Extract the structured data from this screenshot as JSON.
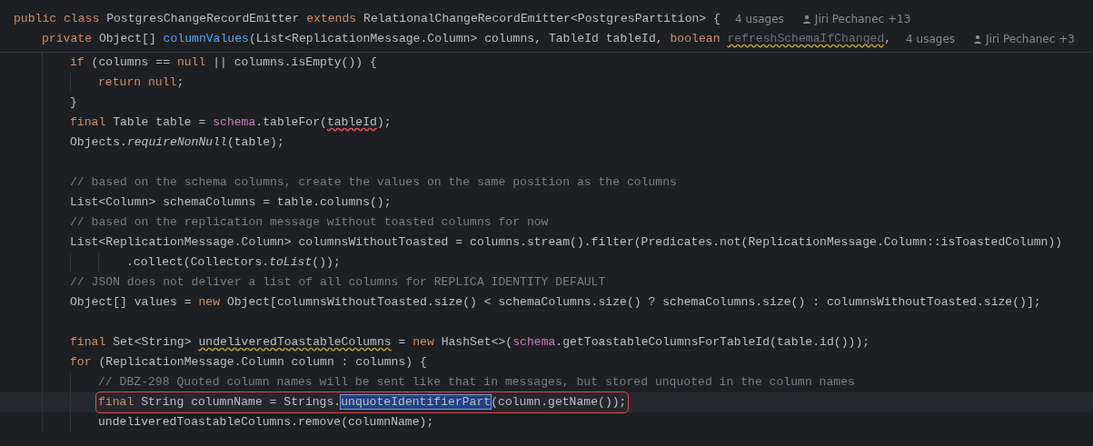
{
  "sticky_header": [
    {
      "tokens": [
        {
          "text": "public class ",
          "kind": "keyword"
        },
        {
          "text": "PostgresChangeRecordEmitter ",
          "kind": "plain"
        },
        {
          "text": "extends ",
          "kind": "keyword"
        },
        {
          "text": "RelationalChangeRecordEmitter<PostgresPartition> {",
          "kind": "plain"
        }
      ],
      "usages": "4 usages",
      "author": "Jiri Pechanec +13",
      "children": [
        {
          "tokens": [
            {
              "text": "private ",
              "kind": "keyword"
            },
            {
              "text": "Object[] ",
              "kind": "plain"
            },
            {
              "text": "columnValues",
              "kind": "declaration"
            },
            {
              "text": "(List<ReplicationMessage.Column> columns, TableId tableId, ",
              "kind": "plain"
            },
            {
              "text": "boolean ",
              "kind": "keyword"
            },
            {
              "text": "refreshSchemaIfChanged",
              "kind": "unused"
            },
            {
              "text": ",",
              "kind": "plain"
            }
          ],
          "usages": "4 usages",
          "author": "Jiri Pechanec +3"
        }
      ]
    }
  ],
  "lines": [
    {
      "kind": "code",
      "tokens": [
        {
          "text": "if ",
          "kind": "keyword"
        },
        {
          "text": "(columns == ",
          "kind": "plain"
        },
        {
          "text": "null",
          "kind": "keyword"
        },
        {
          "text": " || columns.isEmpty()) {",
          "kind": "plain"
        }
      ],
      "children": [
        {
          "kind": "code",
          "tokens": [
            {
              "text": "return null",
              "kind": "keyword"
            },
            {
              "text": ";",
              "kind": "plain"
            }
          ]
        }
      ]
    },
    {
      "kind": "code",
      "tokens": [
        {
          "text": "}",
          "kind": "plain"
        }
      ]
    },
    {
      "kind": "code",
      "tokens": [
        {
          "text": "final ",
          "kind": "keyword"
        },
        {
          "text": "Table table = ",
          "kind": "plain"
        },
        {
          "text": "schema",
          "kind": "field"
        },
        {
          "text": ".tableFor(",
          "kind": "plain"
        },
        {
          "text": "tableId",
          "kind": "error"
        },
        {
          "text": ");",
          "kind": "plain"
        }
      ]
    },
    {
      "kind": "code",
      "tokens": [
        {
          "text": "Objects.",
          "kind": "plain"
        },
        {
          "text": "requireNonNull",
          "kind": "static"
        },
        {
          "text": "(table);",
          "kind": "plain"
        }
      ]
    },
    {
      "kind": "blank"
    },
    {
      "kind": "code",
      "tokens": [
        {
          "text": "// based on the schema columns, create the values on the same position as the columns",
          "kind": "comment"
        }
      ]
    },
    {
      "kind": "code",
      "tokens": [
        {
          "text": "List<Column> schemaColumns = table.columns();",
          "kind": "plain"
        }
      ]
    },
    {
      "kind": "code",
      "tokens": [
        {
          "text": "// based on the replication message without toasted columns for now",
          "kind": "comment"
        }
      ]
    },
    {
      "kind": "code",
      "tokens": [
        {
          "text": "List<ReplicationMessage.Column> columnsWithoutToasted = columns.stream().filter(Predicates.not(ReplicationMessage.Column::isToastedColumn))",
          "kind": "plain"
        }
      ],
      "children": [
        {
          "kind": "continuation",
          "tokens": [
            {
              "text": ".collect(Collectors.",
              "kind": "plain"
            },
            {
              "text": "toList",
              "kind": "static"
            },
            {
              "text": "());",
              "kind": "plain"
            }
          ]
        }
      ]
    },
    {
      "kind": "code",
      "tokens": [
        {
          "text": "// JSON does not deliver a list of all columns for REPLICA IDENTITY DEFAULT",
          "kind": "comment"
        }
      ]
    },
    {
      "kind": "code",
      "tokens": [
        {
          "text": "Object[] values = ",
          "kind": "plain"
        },
        {
          "text": "new ",
          "kind": "keyword"
        },
        {
          "text": "Object[columnsWithoutToasted.size() < schemaColumns.size() ? schemaColumns.size() : columnsWithoutToasted.size()];",
          "kind": "plain"
        }
      ]
    },
    {
      "kind": "blank"
    },
    {
      "kind": "code",
      "tokens": [
        {
          "text": "final ",
          "kind": "keyword"
        },
        {
          "text": "Set<String> ",
          "kind": "plain"
        },
        {
          "text": "undeliveredToastableColumns",
          "kind": "warning"
        },
        {
          "text": " = ",
          "kind": "plain"
        },
        {
          "text": "new ",
          "kind": "keyword"
        },
        {
          "text": "HashSet<>(",
          "kind": "plain"
        },
        {
          "text": "schema",
          "kind": "field"
        },
        {
          "text": ".getToastableColumnsForTableId(table.id()));",
          "kind": "plain"
        }
      ]
    },
    {
      "kind": "code",
      "tokens": [
        {
          "text": "for ",
          "kind": "keyword"
        },
        {
          "text": "(ReplicationMessage.Column column : columns) {",
          "kind": "plain"
        }
      ],
      "children": [
        {
          "kind": "code",
          "tokens": [
            {
              "text": "// DBZ-298 Quoted column names will be sent like that in messages, but stored unquoted in the column names",
              "kind": "comment"
            }
          ]
        },
        {
          "kind": "code",
          "current": true,
          "boxed": true,
          "tokens": [
            {
              "text": "final ",
              "kind": "keyword"
            },
            {
              "text": "String columnName = Strings.",
              "kind": "plain"
            },
            {
              "text": "unquoteIdentifierPart",
              "kind": "selected"
            },
            {
              "text": "(column.getName());",
              "kind": "plain"
            }
          ]
        },
        {
          "kind": "code",
          "tokens": [
            {
              "text": "undeliveredToastableColumns.remove(columnName);",
              "kind": "plain"
            }
          ]
        }
      ]
    }
  ]
}
